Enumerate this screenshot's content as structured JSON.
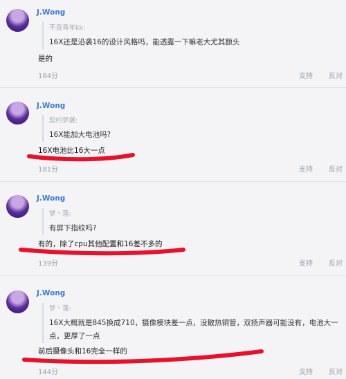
{
  "comments": [
    {
      "username": "J.Wong",
      "quote_user": "不良青年kk:",
      "quote_text": "16X还是沿袭16的设计风格吗，能透露一下嘛老大尤其额头",
      "reply": "是的",
      "score": "184分",
      "support": "支持",
      "oppose": "反对"
    },
    {
      "username": "J.Wong",
      "quote_user": "契约梦屠:",
      "quote_text": "16X能加大电池吗?",
      "reply": "16X电池比16大一点",
      "score": "181分",
      "support": "支持",
      "oppose": "反对"
    },
    {
      "username": "J.Wong",
      "quote_user": "梦丶落:",
      "quote_text": "有屏下指纹吗?",
      "reply": "有的，除了cpu其他配置和16差不多的",
      "score": "139分",
      "support": "支持",
      "oppose": "反对"
    },
    {
      "username": "J.Wong",
      "quote_user": "梦丶落:",
      "quote_text": "16X大概就是845换成710，摄像模块差一点，没散热铜管，双扬声器可能没有，电池大一点，更厚了一点",
      "reply": "前后摄像头和16完全一样的",
      "score": "144分",
      "support": "支持",
      "oppose": "反对"
    }
  ],
  "colors": {
    "username": "#3d7bd6",
    "highlight_stroke": "#e8102a",
    "muted": "#9aa0a8"
  }
}
